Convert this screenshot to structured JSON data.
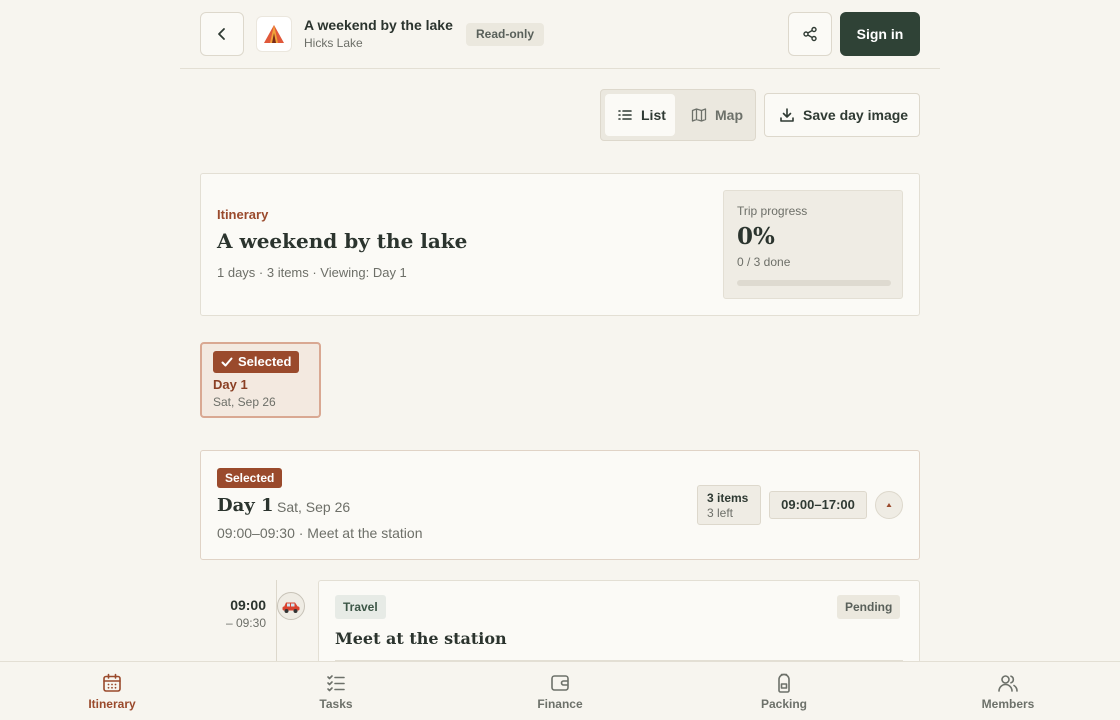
{
  "header": {
    "trip_title": "A weekend by the lake",
    "trip_location": "Hicks Lake",
    "access_badge": "Read-only",
    "sign_in_label": "Sign in"
  },
  "toolbar": {
    "view_list_label": "List",
    "view_map_label": "Map",
    "active_view": "List",
    "save_day_image_label": "Save day image"
  },
  "summary": {
    "section_label": "Itinerary",
    "title": "A weekend by the lake",
    "meta": "1 days · 3 items · Viewing: Day 1",
    "progress": {
      "label": "Trip progress",
      "value": "0%",
      "done_text": "0 / 3 done",
      "fraction": 0
    }
  },
  "day_selector": {
    "days": [
      {
        "selected_label": "Selected",
        "day": "Day 1",
        "date": "Sat, Sep 26"
      }
    ]
  },
  "day_card": {
    "badge": "Selected",
    "day": "Day 1",
    "date": "Sat, Sep 26",
    "summary": "09:00–09:30 · Meet at the station",
    "items_count": "3 items",
    "items_left": "3 left",
    "time_range": "09:00–17:00"
  },
  "timeline": [
    {
      "start": "09:00",
      "end": "– 09:30",
      "icon": "car-icon",
      "category": "Travel",
      "status": "Pending",
      "title": "Meet at the station"
    }
  ],
  "bottom_nav": [
    {
      "label": "Itinerary",
      "icon": "calendar-icon",
      "active": true
    },
    {
      "label": "Tasks",
      "icon": "checklist-icon",
      "active": false
    },
    {
      "label": "Finance",
      "icon": "wallet-icon",
      "active": false
    },
    {
      "label": "Packing",
      "icon": "backpack-icon",
      "active": false
    },
    {
      "label": "Members",
      "icon": "users-icon",
      "active": false
    }
  ],
  "colors": {
    "accent": "#9a4a2c",
    "primary_dark": "#2f4236",
    "background": "#f7f5ef"
  }
}
